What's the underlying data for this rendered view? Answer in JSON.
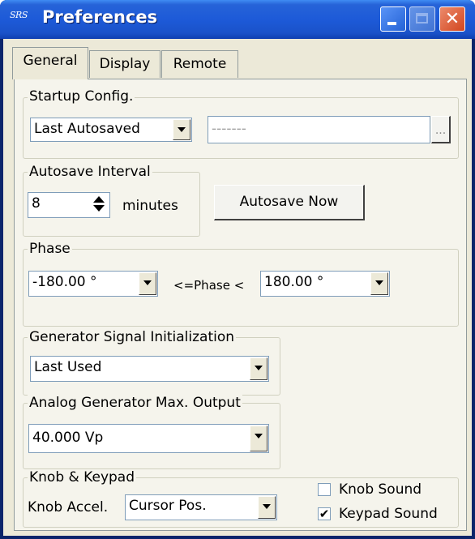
{
  "window": {
    "title": "Preferences",
    "icon_text": "SRS"
  },
  "tabs": [
    {
      "label": "General",
      "active": true
    },
    {
      "label": "Display",
      "active": false
    },
    {
      "label": "Remote",
      "active": false
    }
  ],
  "startup": {
    "legend": "Startup Config.",
    "selected": "Last Autosaved",
    "path_value": "-------",
    "browse_label": "..."
  },
  "autosave": {
    "legend": "Autosave Interval",
    "value": "8",
    "unit": "minutes",
    "button_label": "Autosave Now"
  },
  "phase": {
    "legend": "Phase",
    "min_value": "-180.00 °",
    "relation": "<=Phase <",
    "max_value": "180.00 °"
  },
  "generator_init": {
    "legend": "Generator Signal Initialization",
    "selected": "Last Used"
  },
  "analog_max": {
    "legend": "Analog Generator Max. Output",
    "selected": "40.000 Vp"
  },
  "knob": {
    "legend": "Knob & Keypad",
    "accel_label": "Knob Accel.",
    "accel_value": "Cursor Pos.",
    "knob_sound_label": "Knob Sound",
    "knob_sound_checked": false,
    "keypad_sound_label": "Keypad Sound",
    "keypad_sound_checked": true,
    "check_mark": "✔"
  }
}
